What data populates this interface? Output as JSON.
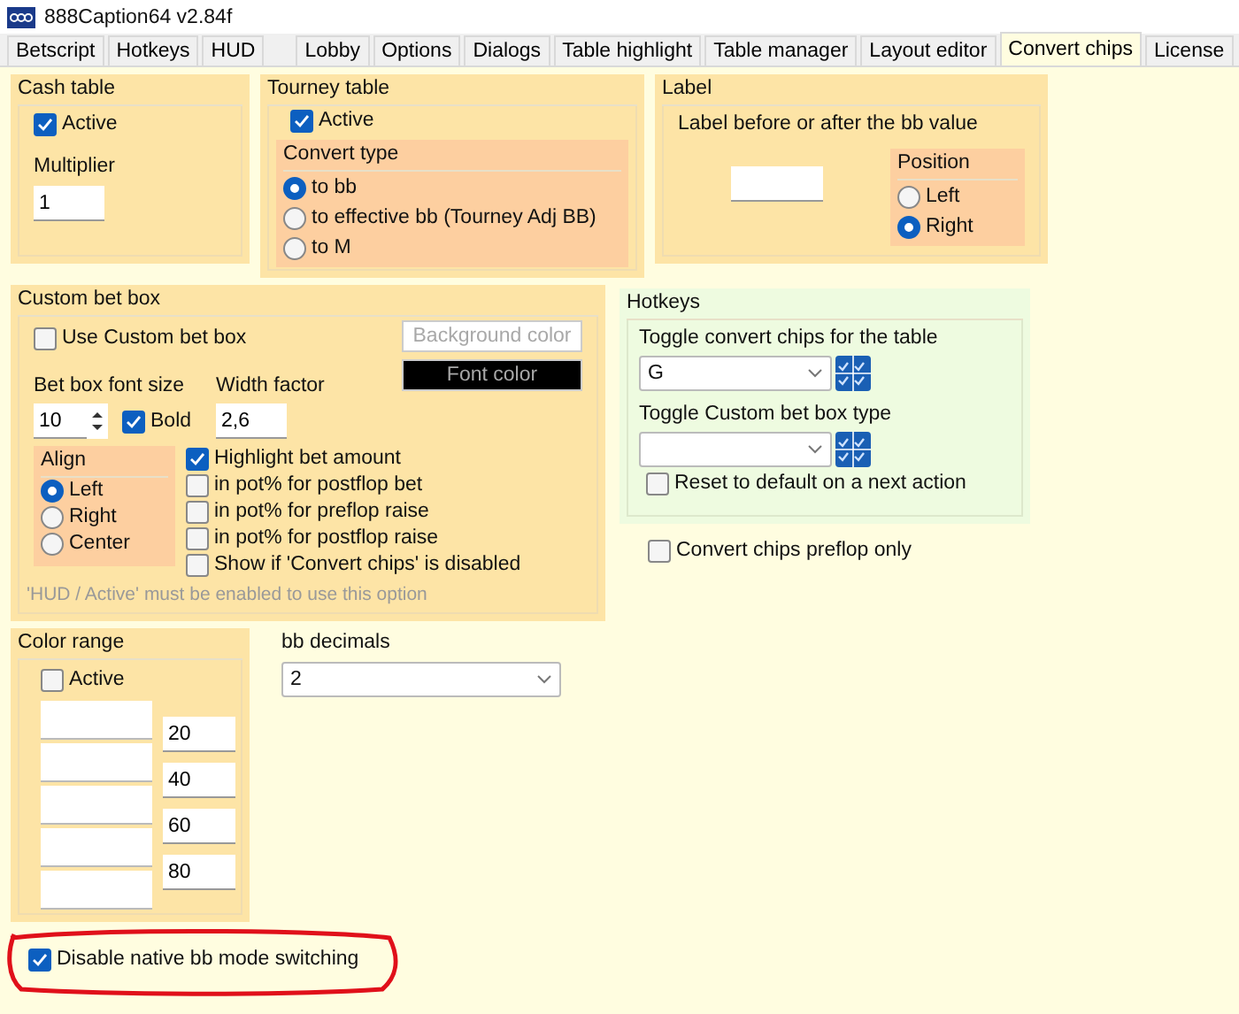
{
  "window": {
    "title": "888Caption64 v2.84f"
  },
  "tabs": [
    {
      "label": "Betscript",
      "selected": false
    },
    {
      "label": "Hotkeys",
      "selected": false
    },
    {
      "label": "HUD",
      "selected": false
    },
    {
      "label": "Lobby",
      "selected": false
    },
    {
      "label": "Options",
      "selected": false
    },
    {
      "label": "Dialogs",
      "selected": false
    },
    {
      "label": "Table highlight",
      "selected": false
    },
    {
      "label": "Table manager",
      "selected": false
    },
    {
      "label": "Layout editor",
      "selected": false
    },
    {
      "label": "Convert chips",
      "selected": true
    },
    {
      "label": "License",
      "selected": false
    }
  ],
  "cash_table": {
    "title": "Cash table",
    "active": {
      "label": "Active",
      "checked": true
    },
    "multiplier_label": "Multiplier",
    "multiplier_value": "1"
  },
  "tourney_table": {
    "title": "Tourney table",
    "active": {
      "label": "Active",
      "checked": true
    },
    "convert_type": {
      "title": "Convert type",
      "options": [
        {
          "label": "to bb",
          "selected": true
        },
        {
          "label": "to effective bb (Tourney Adj BB)",
          "selected": false
        },
        {
          "label": "to M",
          "selected": false
        }
      ]
    }
  },
  "label": {
    "title": "Label",
    "description": "Label before or after the bb value",
    "position": {
      "title": "Position",
      "options": [
        {
          "label": "Left",
          "selected": false
        },
        {
          "label": "Right",
          "selected": true
        }
      ]
    }
  },
  "custom_bet_box": {
    "title": "Custom bet box",
    "use": {
      "label": "Use Custom bet box",
      "checked": false
    },
    "color_buttons": [
      {
        "label": "Background color",
        "color": "#ffffff"
      },
      {
        "label": "Font color",
        "color": "#000000"
      }
    ],
    "font_size_label": "Bet box font size",
    "font_size_value": "10",
    "bold": {
      "label": "Bold",
      "checked": true
    },
    "width_label": "Width factor",
    "width_value": "2,6",
    "align": {
      "title": "Align",
      "options": [
        {
          "label": "Left",
          "selected": true
        },
        {
          "label": "Right",
          "selected": false
        },
        {
          "label": "Center",
          "selected": false
        }
      ]
    },
    "options": [
      {
        "label": "Highlight bet amount",
        "checked": true
      },
      {
        "label": "in pot% for postflop bet",
        "checked": false
      },
      {
        "label": "in pot% for preflop raise",
        "checked": false
      },
      {
        "label": "in pot% for postflop raise",
        "checked": false
      },
      {
        "label": "Show if 'Convert chips' is disabled",
        "checked": false
      }
    ],
    "note": "'HUD / Active' must be enabled to use this option"
  },
  "hotkeys": {
    "title": "Hotkeys",
    "items": [
      {
        "label": "Toggle convert chips for the table",
        "value": "G"
      },
      {
        "label": "Toggle Custom bet box type"
      }
    ],
    "reset": {
      "label": "Reset to default on a next action",
      "checked": false
    }
  },
  "preflop_only": {
    "label": "Convert chips preflop only",
    "checked": false
  },
  "color_range": {
    "title": "Color range",
    "active": {
      "label": "Active",
      "checked": false
    },
    "thresholds": [
      "20",
      "40",
      "60",
      "80"
    ]
  },
  "bb_decimals": {
    "label": "bb decimals",
    "value": "2"
  },
  "disable_native": {
    "label": "Disable native bb mode switching",
    "checked": true
  }
}
